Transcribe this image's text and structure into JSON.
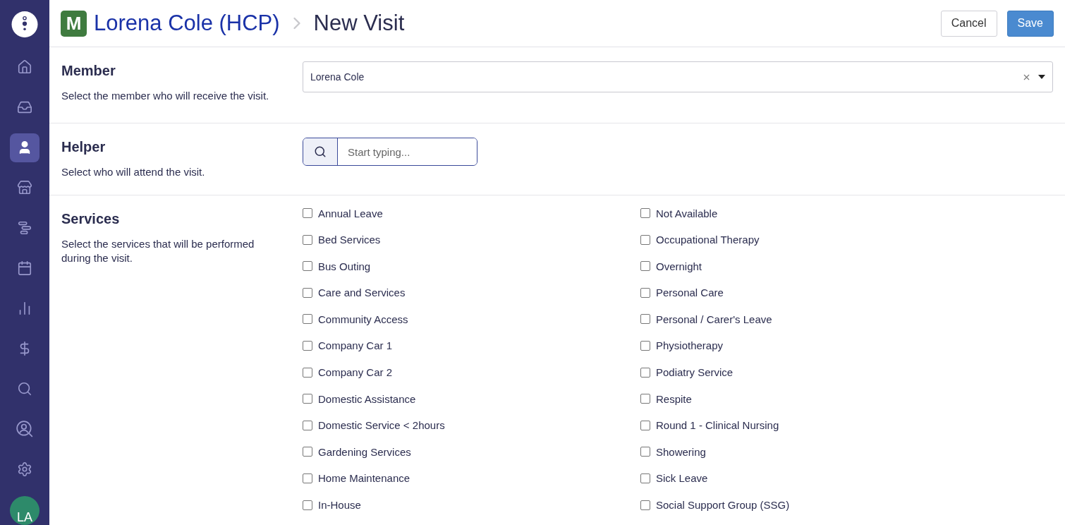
{
  "sidebar": {
    "items": [
      {
        "kind": "home",
        "selected": false
      },
      {
        "kind": "inbox",
        "selected": false
      },
      {
        "kind": "person",
        "selected": true
      },
      {
        "kind": "store",
        "selected": false
      },
      {
        "kind": "timeline",
        "selected": false
      },
      {
        "kind": "calendar",
        "selected": false
      },
      {
        "kind": "chart",
        "selected": false
      },
      {
        "kind": "dollar",
        "selected": false
      },
      {
        "kind": "search",
        "selected": false
      },
      {
        "kind": "user-search",
        "selected": false
      },
      {
        "kind": "settings",
        "selected": false
      }
    ],
    "avatar": "LA"
  },
  "header": {
    "badge": "M",
    "parent": "Lorena Cole (HCP)",
    "title": "New Visit",
    "buttons": [
      {
        "label": "Cancel",
        "kind": "secondary"
      },
      {
        "label": "Save",
        "kind": "primary"
      }
    ]
  },
  "member": {
    "title": "Member",
    "description": "Select the member who will receive the visit.",
    "value": "Lorena Cole"
  },
  "helper": {
    "title": "Helper",
    "description": "Select who will attend the visit.",
    "placeholder": "Start typing..."
  },
  "services": {
    "title": "Services",
    "description": "Select the services that will be performed during the visit.",
    "items": [
      {
        "label": "Annual Leave",
        "checked": false
      },
      {
        "label": "Bed Services",
        "checked": false
      },
      {
        "label": "Bus Outing",
        "checked": false
      },
      {
        "label": "Care and Services",
        "checked": false
      },
      {
        "label": "Community Access",
        "checked": false
      },
      {
        "label": "Company Car 1",
        "checked": false
      },
      {
        "label": "Company Car 2",
        "checked": false
      },
      {
        "label": "Domestic Assistance",
        "checked": false
      },
      {
        "label": "Domestic Service < 2hours",
        "checked": false
      },
      {
        "label": "Gardening Services",
        "checked": false
      },
      {
        "label": "Home Maintenance",
        "checked": false
      },
      {
        "label": "In-House",
        "checked": false
      },
      {
        "label": "Not Available",
        "checked": false
      },
      {
        "label": "Occupational Therapy",
        "checked": false
      },
      {
        "label": "Overnight",
        "checked": false
      },
      {
        "label": "Personal Care",
        "checked": false
      },
      {
        "label": "Personal / Carer's Leave",
        "checked": false
      },
      {
        "label": "Physiotherapy",
        "checked": false
      },
      {
        "label": "Podiatry Service",
        "checked": false
      },
      {
        "label": "Respite",
        "checked": false
      },
      {
        "label": "Round 1 - Clinical Nursing",
        "checked": false
      },
      {
        "label": "Showering",
        "checked": false
      },
      {
        "label": "Sick Leave",
        "checked": false
      },
      {
        "label": "Social Support Group (SSG)",
        "checked": false
      }
    ]
  }
}
